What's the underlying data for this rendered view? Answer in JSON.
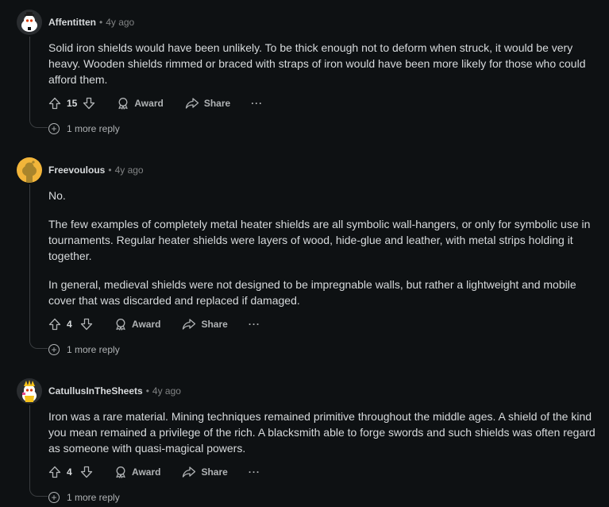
{
  "comments": [
    {
      "author": "Affentitten",
      "time": "4y ago",
      "avatar": "snoo-avatar",
      "paragraphs": [
        "Solid iron shields would have been unlikely. To be thick enough not to deform when struck, it would be very heavy. Wooden shields rimmed or braced with straps of iron would have been more likely for those who could afford them."
      ],
      "score": "15",
      "award_label": "Award",
      "share_label": "Share",
      "more_label": "···",
      "replies_label": "1 more reply"
    },
    {
      "author": "Freevoulous",
      "time": "4y ago",
      "avatar": "snoo-avatar",
      "paragraphs": [
        "No.",
        "The few examples of completely metal heater shields are all symbolic wall-hangers, or only for symbolic use in tournaments. Regular heater shields were layers of wood, hide-glue and leather, with metal strips holding it together.",
        "In general, medieval shields were not designed to be impregnable walls, but rather a lightweight and mobile cover that was discarded and replaced if damaged."
      ],
      "score": "4",
      "award_label": "Award",
      "share_label": "Share",
      "more_label": "···",
      "replies_label": "1 more reply"
    },
    {
      "author": "CatullusInTheSheets",
      "time": "4y ago",
      "avatar": "snoo-avatar",
      "paragraphs": [
        "Iron was a rare material. Mining techniques remained primitive throughout the middle ages. A shield of the kind you mean remained a privilege of the rich. A blacksmith able to forge swords and such shields was often regard as someone with quasi-magical powers."
      ],
      "score": "4",
      "award_label": "Award",
      "share_label": "Share",
      "more_label": "···",
      "replies_label": "1 more reply"
    }
  ],
  "separator": "•",
  "colors": {
    "background": "#0e1113",
    "text": "#d7dadc",
    "muted": "#818384",
    "thread_line": "#3a3d40"
  }
}
